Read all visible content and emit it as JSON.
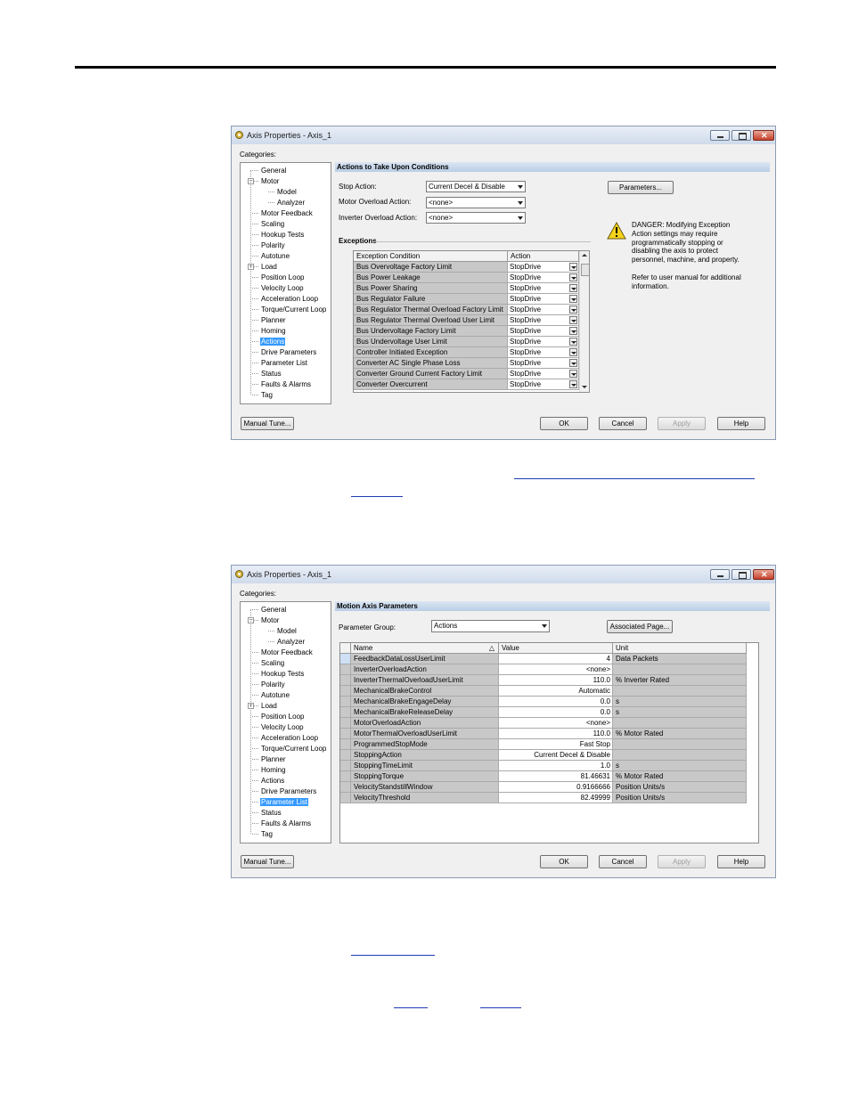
{
  "dialog1": {
    "title": "Axis Properties - Axis_1",
    "categories_label": "Categories:",
    "tree": [
      {
        "label": "General",
        "indent": 1
      },
      {
        "label": "Motor",
        "indent": 1,
        "expander": "minus"
      },
      {
        "label": "Model",
        "indent": 2
      },
      {
        "label": "Analyzer",
        "indent": 2
      },
      {
        "label": "Motor Feedback",
        "indent": 1
      },
      {
        "label": "Scaling",
        "indent": 1
      },
      {
        "label": "Hookup Tests",
        "indent": 1
      },
      {
        "label": "Polarity",
        "indent": 1
      },
      {
        "label": "Autotune",
        "indent": 1
      },
      {
        "label": "Load",
        "indent": 1,
        "expander": "plus"
      },
      {
        "label": "Position Loop",
        "indent": 1
      },
      {
        "label": "Velocity Loop",
        "indent": 1
      },
      {
        "label": "Acceleration Loop",
        "indent": 1
      },
      {
        "label": "Torque/Current Loop",
        "indent": 1
      },
      {
        "label": "Planner",
        "indent": 1
      },
      {
        "label": "Homing",
        "indent": 1
      },
      {
        "label": "Actions",
        "indent": 1,
        "selected": true
      },
      {
        "label": "Drive Parameters",
        "indent": 1
      },
      {
        "label": "Parameter List",
        "indent": 1
      },
      {
        "label": "Status",
        "indent": 1
      },
      {
        "label": "Faults & Alarms",
        "indent": 1
      },
      {
        "label": "Tag",
        "indent": 1
      }
    ],
    "section_title": "Actions to Take Upon Conditions",
    "stop_action_label": "Stop Action:",
    "stop_action_value": "Current Decel & Disable",
    "motor_overload_label": "Motor Overload Action:",
    "motor_overload_value": "<none>",
    "inverter_overload_label": "Inverter Overload Action:",
    "inverter_overload_value": "<none>",
    "parameters_button": "Parameters...",
    "danger_text": "DANGER: Modifying Exception Action settings may require programmatically stopping or disabling the axis to protect personnel, machine, and property.",
    "danger_refer": "Refer to user manual for additional information.",
    "exceptions_label": "Exceptions",
    "col_condition": "Exception Condition",
    "col_action": "Action",
    "exceptions": [
      {
        "condition": "Bus Overvoltage Factory Limit",
        "action": "StopDrive"
      },
      {
        "condition": "Bus Power Leakage",
        "action": "StopDrive"
      },
      {
        "condition": "Bus Power Sharing",
        "action": "StopDrive"
      },
      {
        "condition": "Bus Regulator Failure",
        "action": "StopDrive"
      },
      {
        "condition": "Bus Regulator Thermal Overload Factory Limit",
        "action": "StopDrive"
      },
      {
        "condition": "Bus Regulator Thermal Overload User Limit",
        "action": "StopDrive"
      },
      {
        "condition": "Bus Undervoltage Factory Limit",
        "action": "StopDrive"
      },
      {
        "condition": "Bus Undervoltage User Limit",
        "action": "StopDrive"
      },
      {
        "condition": "Controller Initiated Exception",
        "action": "StopDrive"
      },
      {
        "condition": "Converter AC Single Phase Loss",
        "action": "StopDrive"
      },
      {
        "condition": "Converter Ground Current Factory Limit",
        "action": "StopDrive"
      },
      {
        "condition": "Converter Overcurrent",
        "action": "StopDrive"
      }
    ],
    "buttons": {
      "manual_tune": "Manual Tune...",
      "ok": "OK",
      "cancel": "Cancel",
      "apply": "Apply",
      "help": "Help"
    }
  },
  "dialog2": {
    "title": "Axis Properties - Axis_1",
    "categories_label": "Categories:",
    "tree": [
      {
        "label": "General",
        "indent": 1
      },
      {
        "label": "Motor",
        "indent": 1,
        "expander": "minus"
      },
      {
        "label": "Model",
        "indent": 2
      },
      {
        "label": "Analyzer",
        "indent": 2
      },
      {
        "label": "Motor Feedback",
        "indent": 1
      },
      {
        "label": "Scaling",
        "indent": 1
      },
      {
        "label": "Hookup Tests",
        "indent": 1
      },
      {
        "label": "Polarity",
        "indent": 1
      },
      {
        "label": "Autotune",
        "indent": 1
      },
      {
        "label": "Load",
        "indent": 1,
        "expander": "plus"
      },
      {
        "label": "Position Loop",
        "indent": 1
      },
      {
        "label": "Velocity Loop",
        "indent": 1
      },
      {
        "label": "Acceleration Loop",
        "indent": 1
      },
      {
        "label": "Torque/Current Loop",
        "indent": 1
      },
      {
        "label": "Planner",
        "indent": 1
      },
      {
        "label": "Homing",
        "indent": 1
      },
      {
        "label": "Actions",
        "indent": 1
      },
      {
        "label": "Drive Parameters",
        "indent": 1
      },
      {
        "label": "Parameter List",
        "indent": 1,
        "selected": true
      },
      {
        "label": "Status",
        "indent": 1
      },
      {
        "label": "Faults & Alarms",
        "indent": 1
      },
      {
        "label": "Tag",
        "indent": 1
      }
    ],
    "section_title": "Motion Axis Parameters",
    "param_group_label": "Parameter Group:",
    "param_group_value": "Actions",
    "associated_button": "Associated Page...",
    "col_name": "Name",
    "col_sort": "△",
    "col_value": "Value",
    "col_unit": "Unit",
    "params": [
      {
        "name": "FeedbackDataLossUserLimit",
        "value": "4",
        "unit": "Data Packets"
      },
      {
        "name": "InverterOverloadAction",
        "value": "<none>",
        "unit": ""
      },
      {
        "name": "InverterThermalOverloadUserLimit",
        "value": "110.0",
        "unit": "% Inverter Rated"
      },
      {
        "name": "MechanicalBrakeControl",
        "value": "Automatic",
        "unit": ""
      },
      {
        "name": "MechanicalBrakeEngageDelay",
        "value": "0.0",
        "unit": "s"
      },
      {
        "name": "MechanicalBrakeReleaseDelay",
        "value": "0.0",
        "unit": "s"
      },
      {
        "name": "MotorOverloadAction",
        "value": "<none>",
        "unit": ""
      },
      {
        "name": "MotorThermalOverloadUserLimit",
        "value": "110.0",
        "unit": "% Motor Rated"
      },
      {
        "name": "ProgrammedStopMode",
        "value": "Fast Stop",
        "unit": ""
      },
      {
        "name": "StoppingAction",
        "value": "Current Decel & Disable",
        "unit": ""
      },
      {
        "name": "StoppingTimeLimit",
        "value": "1.0",
        "unit": "s"
      },
      {
        "name": "StoppingTorque",
        "value": "81.46631",
        "unit": "% Motor Rated"
      },
      {
        "name": "VelocityStandstillWindow",
        "value": "0.9166666",
        "unit": "Position Units/s"
      },
      {
        "name": "VelocityThreshold",
        "value": "82.49999",
        "unit": "Position Units/s"
      }
    ],
    "buttons": {
      "manual_tune": "Manual Tune...",
      "ok": "OK",
      "cancel": "Cancel",
      "apply": "Apply",
      "help": "Help"
    }
  }
}
